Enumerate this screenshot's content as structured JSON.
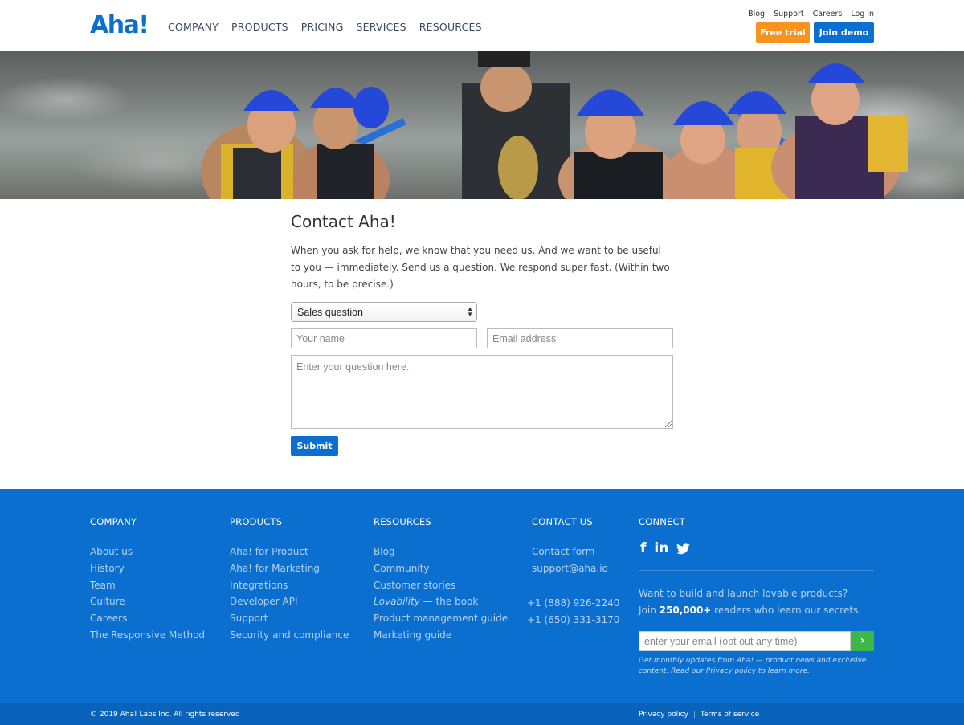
{
  "header": {
    "logo": "Aha!",
    "main_nav": [
      "COMPANY",
      "PRODUCTS",
      "PRICING",
      "SERVICES",
      "RESOURCES"
    ],
    "top_nav": [
      "Blog",
      "Support",
      "Careers",
      "Log in"
    ],
    "free_trial": "Free trial",
    "join_demo": "Join demo"
  },
  "hero": {
    "alt": "Team photo whitewater rafting"
  },
  "contact": {
    "title": "Contact Aha!",
    "intro": "When you ask for help, we know that you need us. And we want to be useful to you — immediately. Send us a question. We respond super fast. (Within two hours, to be precise.)",
    "select_value": "Sales question",
    "name_placeholder": "Your name",
    "email_placeholder": "Email address",
    "question_placeholder": "Enter your question here.",
    "submit": "Submit"
  },
  "footer": {
    "company": {
      "heading": "COMPANY",
      "links": [
        "About us",
        "History",
        "Team",
        "Culture",
        "Careers",
        "The Responsive Method"
      ]
    },
    "products": {
      "heading": "PRODUCTS",
      "links": [
        "Aha! for Product",
        "Aha! for Marketing",
        "Integrations",
        "Developer API",
        "Support",
        "Security and compliance"
      ]
    },
    "resources": {
      "heading": "RESOURCES",
      "links": [
        "Blog",
        "Community",
        "Customer stories",
        "Lovability",
        "— the book",
        "Product management guide",
        "Marketing guide"
      ]
    },
    "contact": {
      "heading": "CONTACT US",
      "links": [
        "Contact form",
        "support@aha.io"
      ],
      "phones": [
        "+1 (888) 926-2240",
        "+1 (650) 331-3170"
      ]
    },
    "connect": {
      "heading": "CONNECT",
      "social_icons": [
        "facebook-icon",
        "linkedin-icon",
        "twitter-icon"
      ],
      "pitch_line1": "Want to build and launch lovable products?",
      "pitch_pre": "Join ",
      "pitch_bold": "250,000+",
      "pitch_post": " readers who learn our secrets.",
      "email_placeholder": "enter your email (opt out any time)",
      "note_pre": "Get monthly updates from Aha! — product news and exclusive content. Read our ",
      "note_link": "Privacy policy",
      "note_post": " to learn more."
    },
    "copyright": "© 2019 Aha! Labs Inc. All rights reserved",
    "privacy": "Privacy policy",
    "separator": "|",
    "terms": "Terms of service"
  },
  "colors": {
    "brand_blue": "#0b6fd0",
    "trial_orange": "#f7931e",
    "go_green": "#3fb64a"
  }
}
